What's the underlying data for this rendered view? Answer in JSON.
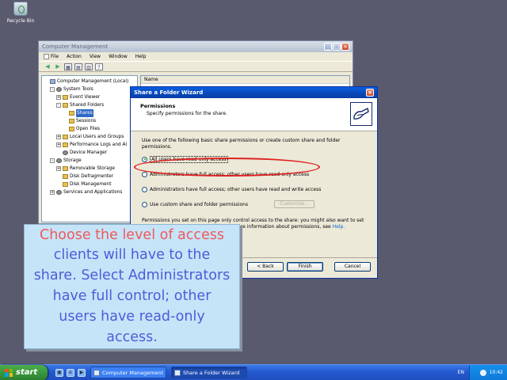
{
  "desktop": {
    "recycle_label": "Recycle Bin"
  },
  "computer_management": {
    "title": "Computer Management",
    "menu": [
      "File",
      "Action",
      "View",
      "Window",
      "Help"
    ],
    "right_header": "Name",
    "tree": [
      {
        "label": "Computer Management (Local)",
        "depth": 0,
        "expander": "",
        "icon": "pc"
      },
      {
        "label": "System Tools",
        "depth": 1,
        "expander": "−",
        "icon": "gear"
      },
      {
        "label": "Event Viewer",
        "depth": 2,
        "expander": "+",
        "icon": "folder"
      },
      {
        "label": "Shared Folders",
        "depth": 2,
        "expander": "−",
        "icon": "folder"
      },
      {
        "label": "Shares",
        "depth": 3,
        "expander": "",
        "icon": "folder",
        "selected": true
      },
      {
        "label": "Sessions",
        "depth": 3,
        "expander": "",
        "icon": "folder"
      },
      {
        "label": "Open Files",
        "depth": 3,
        "expander": "",
        "icon": "folder"
      },
      {
        "label": "Local Users and Groups",
        "depth": 2,
        "expander": "+",
        "icon": "folder"
      },
      {
        "label": "Performance Logs and Al",
        "depth": 2,
        "expander": "+",
        "icon": "folder"
      },
      {
        "label": "Device Manager",
        "depth": 2,
        "expander": "",
        "icon": "gear"
      },
      {
        "label": "Storage",
        "depth": 1,
        "expander": "−",
        "icon": "gear"
      },
      {
        "label": "Removable Storage",
        "depth": 2,
        "expander": "+",
        "icon": "folder"
      },
      {
        "label": "Disk Defragmenter",
        "depth": 2,
        "expander": "",
        "icon": "folder"
      },
      {
        "label": "Disk Management",
        "depth": 2,
        "expander": "",
        "icon": "folder"
      },
      {
        "label": "Services and Applications",
        "depth": 1,
        "expander": "+",
        "icon": "gear"
      }
    ]
  },
  "wizard": {
    "title": "Share a Folder Wizard",
    "heading": "Permissions",
    "subheading": "Specify permissions for the share.",
    "intro": "Use one of the following basic share permissions or create custom share and folder permissions.",
    "options": [
      {
        "label": "All users have read-only access",
        "selected": true
      },
      {
        "label": "Administrators have full access; other users have read-only access",
        "selected": false
      },
      {
        "label": "Administrators have full access; other users have read and write access",
        "selected": false
      },
      {
        "label": "Use custom share and folder permissions",
        "selected": false
      }
    ],
    "customize_label": "Customize...",
    "note": "Permissions you set on this page only control access to the share: you might also want to set",
    "note2_pre": "",
    "note2": "For more information about permissions, see",
    "help_link": "Help.",
    "buttons": {
      "back": "< Back",
      "finish": "Finish",
      "cancel": "Cancel"
    }
  },
  "callout": {
    "text": "Choose the level of access clients will have to the share. Select Administrators have full control; other users have read-only access.",
    "highlight_word": "Choose the level of access"
  },
  "taskbar": {
    "start_label": "start",
    "tasks": [
      {
        "label": "Computer Management",
        "active": false
      },
      {
        "label": "Share a Folder Wizard",
        "active": true
      }
    ],
    "language": "EN",
    "clock": "10:42"
  }
}
